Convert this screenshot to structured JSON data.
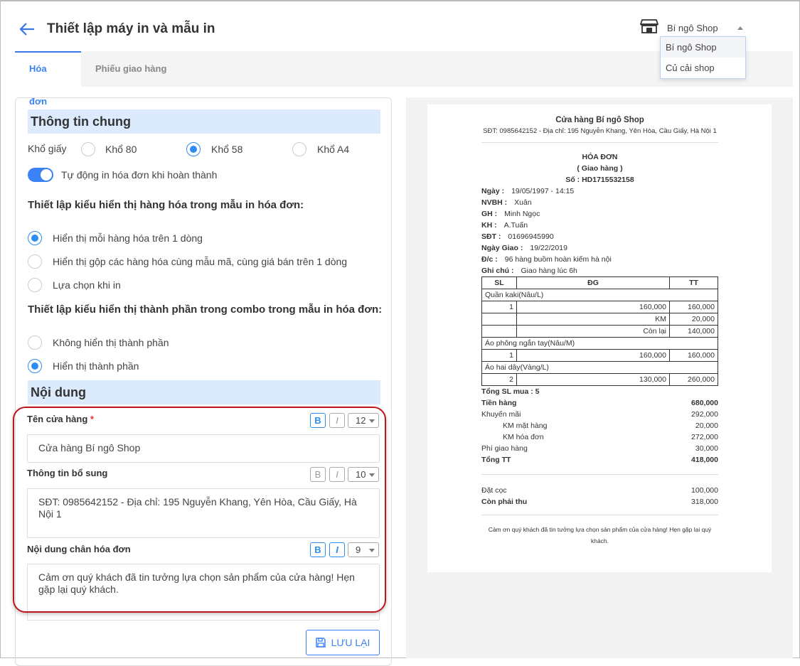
{
  "header": {
    "title": "Thiết lập máy in và mẫu in",
    "shop_selected": "Bí ngô Shop",
    "shop_options": [
      "Bí ngô Shop",
      "Củ cải shop"
    ]
  },
  "tabs": [
    {
      "label": "Hóa đơn",
      "active": true
    },
    {
      "label": "Phiếu giao hàng",
      "active": false
    }
  ],
  "colors": {
    "accent": "#3b82f6",
    "section_bg": "#dbeafc",
    "highlight_outline": "#c0141c"
  },
  "general": {
    "title": "Thông tin chung",
    "paper_label": "Khổ giấy",
    "paper_options": [
      "Khổ 80",
      "Khổ 58",
      "Khổ A4"
    ],
    "paper_selected": "Khổ 58",
    "auto_print_label": "Tự động in hóa đơn khi hoàn thành",
    "auto_print": true,
    "item_display_heading": "Thiết lập kiểu hiển thị hàng hóa trong mẫu in hóa đơn:",
    "item_display_options": [
      "Hiển thị mỗi hàng hóa trên 1 dòng",
      "Hiển thị gộp các hàng hóa cùng mẫu mã, cùng giá bán trên 1 dòng",
      "Lựa chọn khi in"
    ],
    "item_display_selected": 0,
    "combo_heading": "Thiết lập kiểu hiển thị thành phần trong combo trong mẫu in hóa đơn:",
    "combo_options": [
      "Không hiển thị thành phần",
      "Hiển thị thành phần"
    ],
    "combo_selected": 1
  },
  "content": {
    "title": "Nội dung",
    "fields": [
      {
        "label": "Tên cửa hàng",
        "required": "*",
        "bold": true,
        "italic": false,
        "size": "12",
        "value": "Cửa hàng Bí ngô Shop"
      },
      {
        "label": "Thông tin bổ sung",
        "bold": false,
        "italic": false,
        "size": "10",
        "value": "SĐT: 0985642152 - Địa chỉ: 195 Nguyễn Khang, Yên Hòa, Cầu Giấy, Hà Nội 1"
      },
      {
        "label": "Nội dung chân hóa đơn",
        "bold": true,
        "italic": true,
        "size": "9",
        "value": "Cảm ơn quý khách đã tin tưởng lựa chọn sản phẩm của cửa hàng! Hẹn gặp lại quý khách."
      }
    ],
    "bold_glyph": "B",
    "italic_glyph": "I",
    "save_label": "LƯU LẠI"
  },
  "receipt": {
    "shop_name": "Cửa hàng Bí ngô Shop",
    "shop_info": "SĐT: 0985642152 - Địa chỉ: 195 Nguyễn Khang, Yên Hòa, Cầu Giấy, Hà Nội 1",
    "title": "HÓA ĐƠN",
    "subtitle": "( Giao hàng )",
    "number": "Số : HD1715532158",
    "info": [
      {
        "k": "Ngày :",
        "v": "19/05/1997 - 14:15"
      },
      {
        "k": "NVBH :",
        "v": "Xuân"
      },
      {
        "k": "GH :",
        "v": "Minh Ngọc"
      },
      {
        "k": "KH :",
        "v": "A.Tuấn"
      },
      {
        "k": "SĐT :",
        "v": "01696945990"
      },
      {
        "k": "Ngày Giao :",
        "v": "19/22/2019"
      },
      {
        "k": "Đ/c :",
        "v": "96 hàng buồm hoàn kiếm hà nội"
      },
      {
        "k": "Ghi chú :",
        "v": "Giao hàng lúc 6h"
      }
    ],
    "table_headers": [
      "SL",
      "ĐG",
      "TT"
    ],
    "items": [
      {
        "name": "Quần kaki(Nâu/L)",
        "rows": [
          [
            "1",
            "160,000",
            "160,000"
          ],
          [
            "",
            "KM",
            "20,000"
          ],
          [
            "",
            "Còn lại",
            "140,000"
          ]
        ]
      },
      {
        "name": "Áo phông ngắn tay(Nâu/M)",
        "rows": [
          [
            "1",
            "160,000",
            "160,000"
          ]
        ]
      },
      {
        "name": "Áo hai dây(Vàng/L)",
        "rows": [
          [
            "2",
            "130,000",
            "260,000"
          ]
        ]
      }
    ],
    "total_qty": "Tổng SL mua : 5",
    "summary": [
      {
        "k": "Tiền hàng",
        "v": "680,000",
        "bold": true
      },
      {
        "k": "Khuyến mãi",
        "v": "292,000"
      },
      {
        "k": "KM mặt hàng",
        "v": "20,000",
        "indent": true
      },
      {
        "k": "KM hóa đơn",
        "v": "272,000",
        "indent": true
      },
      {
        "k": "Phí giao hàng",
        "v": "30,000"
      },
      {
        "k": "Tổng TT",
        "v": "418,000",
        "bold": true
      }
    ],
    "payment": [
      {
        "k": "Đặt cọc",
        "v": "100,000"
      },
      {
        "k": "Còn phải thu",
        "v": "318,000",
        "boldKey": true
      }
    ],
    "footer": "Cảm ơn quý khách đã tin tưởng lựa chọn sản phẩm của cửa hàng! Hẹn gặp lại quý khách."
  }
}
